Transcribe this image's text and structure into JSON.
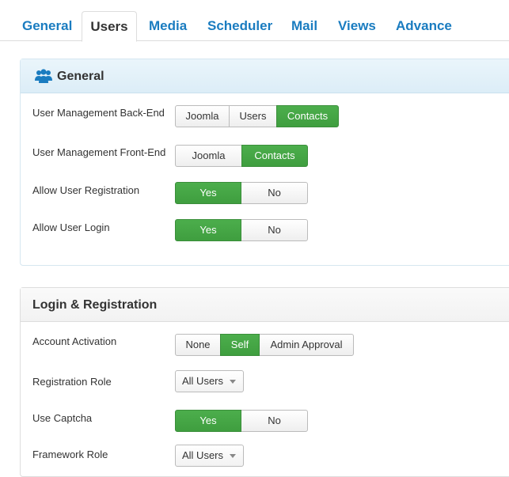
{
  "tabs": [
    {
      "label": "General"
    },
    {
      "label": "Users"
    },
    {
      "label": "Media"
    },
    {
      "label": "Scheduler"
    },
    {
      "label": "Mail"
    },
    {
      "label": "Views"
    },
    {
      "label": "Advance"
    }
  ],
  "active_tab": "Users",
  "general": {
    "title": "General",
    "icon": "users-icon",
    "rows": [
      {
        "label": "User Management Back-End",
        "options": [
          "Joomla",
          "Users",
          "Contacts"
        ],
        "selected": "Contacts"
      },
      {
        "label": "User Management Front-End",
        "options": [
          "Joomla",
          "Contacts"
        ],
        "selected": "Contacts"
      },
      {
        "label": "Allow User Registration",
        "options": [
          "Yes",
          "No"
        ],
        "selected": "Yes"
      },
      {
        "label": "Allow User Login",
        "options": [
          "Yes",
          "No"
        ],
        "selected": "Yes"
      }
    ]
  },
  "login": {
    "title": "Login & Registration",
    "rows": [
      {
        "label": "Account Activation",
        "options": [
          "None",
          "Self",
          "Admin Approval"
        ],
        "selected": "Self"
      },
      {
        "label": "Registration Role",
        "value": "All Users"
      },
      {
        "label": "Use Captcha",
        "options": [
          "Yes",
          "No"
        ],
        "selected": "Yes"
      },
      {
        "label": "Framework Role",
        "value": "All Users"
      }
    ]
  },
  "colors": {
    "accent": "#1a7cc0",
    "on": "#44a844"
  }
}
